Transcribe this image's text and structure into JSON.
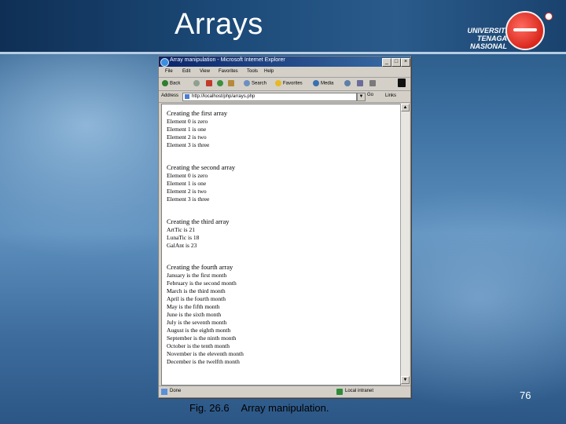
{
  "slide": {
    "title": "Arrays",
    "logo_text": "UNIVERSITI TENAGA NASIONAL",
    "page_number": "76",
    "caption_label": "Fig. 26.6",
    "caption_text": "Array manipulation."
  },
  "browser": {
    "window_title": "Array manipulation - Microsoft Internet Explorer",
    "menu": [
      "File",
      "Edit",
      "View",
      "Favorites",
      "Tools",
      "Help"
    ],
    "toolbar": {
      "back": "Back",
      "search": "Search",
      "favorites": "Favorites",
      "media": "Media"
    },
    "address_label": "Address",
    "url": "http://localhost/php/arrays.php",
    "go_label": "Go",
    "links_label": "Links",
    "status": "Done",
    "zone": "Local intranet"
  },
  "content": {
    "sections": [
      {
        "heading": "Creating the first array",
        "lines": [
          "Element 0 is zero",
          "Element 1 is one",
          "Element 2 is two",
          "Element 3 is three"
        ]
      },
      {
        "heading": "Creating the second array",
        "lines": [
          "Element 0 is zero",
          "Element 1 is one",
          "Element 2 is two",
          "Element 3 is three"
        ]
      },
      {
        "heading": "Creating the third array",
        "lines": [
          "ArtTic is 21",
          "LunaTic is 18",
          "GalAnt is 23"
        ]
      },
      {
        "heading": "Creating the fourth array",
        "lines": [
          "January is the first month",
          "February is the second month",
          "March is the third month",
          "April is the fourth month",
          "May is the fifth month",
          "June is the sixth month",
          "July is the seventh month",
          "August is the eighth month",
          "September is the ninth month",
          "October is the tenth month",
          "November is the eleventh month",
          "December is the twelfth month"
        ]
      }
    ]
  }
}
